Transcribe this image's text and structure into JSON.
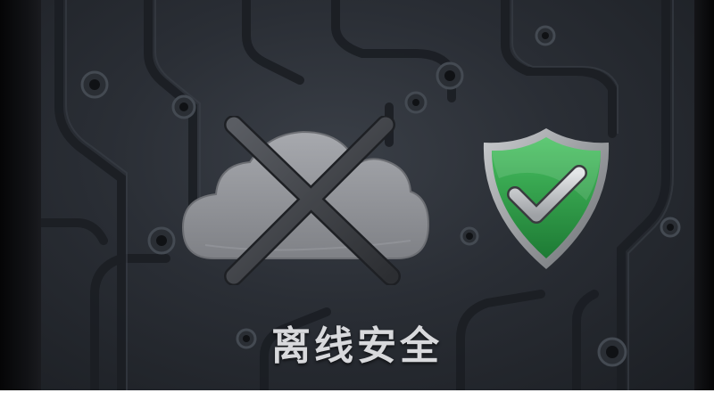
{
  "caption": "离线安全",
  "icons": {
    "cloud": "cloud-offline-icon",
    "shield": "shield-check-icon"
  },
  "colors": {
    "background": "#2a2e35",
    "cloud": "#8f9196",
    "cross": "#3c3f44",
    "shield_green": "#2fa44a",
    "shield_rim": "#9a9ca0",
    "caption_text": "#d8d9dc"
  }
}
